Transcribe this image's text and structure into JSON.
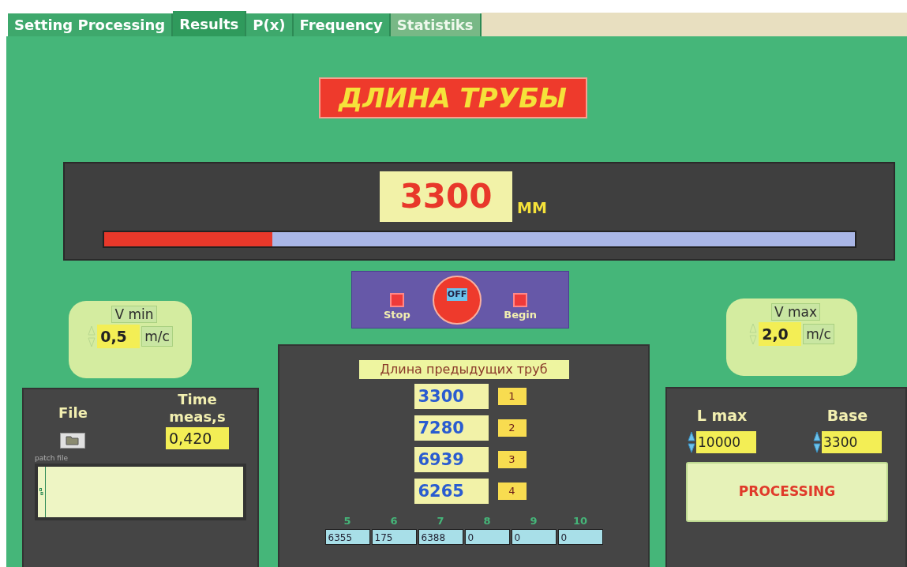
{
  "tabs": [
    {
      "label": "Setting Processing",
      "selected": false,
      "disabled": false
    },
    {
      "label": "Results",
      "selected": true,
      "disabled": false
    },
    {
      "label": "P(x)",
      "selected": false,
      "disabled": false
    },
    {
      "label": "Frequency",
      "selected": false,
      "disabled": false
    },
    {
      "label": "Statistiks",
      "selected": false,
      "disabled": true
    }
  ],
  "title": "ДЛИНА ТРУБЫ",
  "length": {
    "value": "3300",
    "unit": "MM",
    "level": 0.224
  },
  "control": {
    "switch": {
      "label": "OFF",
      "on": false
    },
    "buttons": [
      {
        "label": "Stop"
      },
      {
        "label": "Begin"
      }
    ]
  },
  "v_min": {
    "label": "V min",
    "value": "0,5",
    "unit": "m/c"
  },
  "v_max": {
    "label": "V max",
    "value": "2,0",
    "unit": "m/c"
  },
  "file_panel": {
    "file_label": "File",
    "time_label": "Time meas,s",
    "time_value": "0,420",
    "path_label": "patch file"
  },
  "previous": {
    "title": "Длина предыдущих труб",
    "items": [
      {
        "value": "3300",
        "index": "1"
      },
      {
        "value": "7280",
        "index": "2"
      },
      {
        "value": "6939",
        "index": "3"
      },
      {
        "value": "6265",
        "index": "4"
      }
    ],
    "extra": [
      {
        "index": "5",
        "value": "6355"
      },
      {
        "index": "6",
        "value": "175"
      },
      {
        "index": "7",
        "value": "6388"
      },
      {
        "index": "8",
        "value": "0"
      },
      {
        "index": "9",
        "value": "0"
      },
      {
        "index": "10",
        "value": "0"
      }
    ]
  },
  "processing": {
    "l_max": {
      "label": "L max",
      "value": "10000"
    },
    "base": {
      "label": "Base",
      "value": "3300"
    },
    "button": "PROCESSING"
  }
}
